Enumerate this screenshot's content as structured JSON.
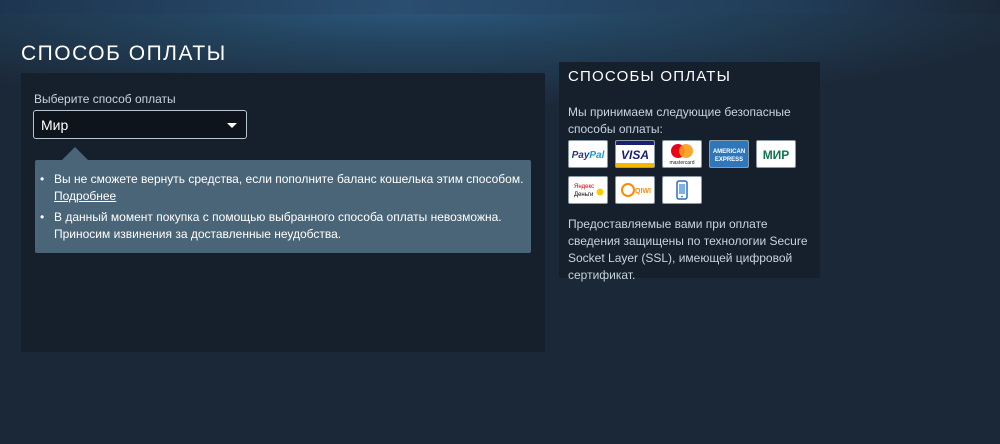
{
  "page": {
    "title": "СПОСОБ ОПЛАТЫ"
  },
  "method": {
    "label": "Выберите способ оплаты",
    "selected": "Мир"
  },
  "notice": {
    "item1_text": "Вы не сможете вернуть средства, если пополните баланс кошелька этим способом.",
    "item1_link": "Подробнее",
    "item2_text": "В данный момент покупка с помощью выбранного способа оплаты невозможна. Приносим извинения за доставленные неудобства."
  },
  "side": {
    "title": "СПОСОБЫ ОПЛАТЫ",
    "accept_text": "Мы принимаем следующие безопасные способы оплаты:",
    "ssl_text": "Предоставляемые вами при оплате сведения защищены по технологии Secure Socket Layer (SSL), имеющей цифровой сертификат."
  },
  "logos": {
    "paypal": {
      "text": "PayPal",
      "icon": "paypal-logo"
    },
    "visa": {
      "text": "VISA",
      "icon": "visa-logo"
    },
    "mastercard": {
      "text": "mastercard",
      "icon": "mastercard-logo"
    },
    "amex_line1": "AMERICAN",
    "amex_line2": "EXPRESS",
    "mir": {
      "text": "МИР",
      "icon": "mir-logo"
    },
    "yandex_line1": "Яндекс",
    "yandex_line2": "Деньги",
    "qiwi": {
      "text": "QIWI",
      "icon": "qiwi-logo"
    },
    "mobile": {
      "icon": "mobile-payment-logo"
    }
  },
  "colors": {
    "background": "#1b2838",
    "panel": "#16202d",
    "notice": "#4a6577",
    "text": "#c6d4df"
  }
}
